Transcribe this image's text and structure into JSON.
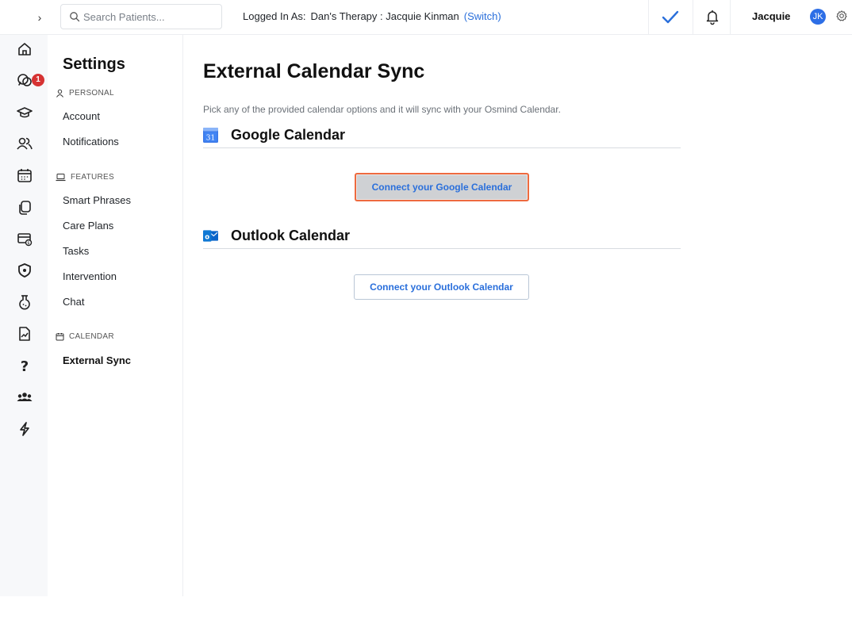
{
  "topbar": {
    "collapse_icon": "chevron-right-icon",
    "search_placeholder": "Search Patients...",
    "logged_in_label": "Logged In As:",
    "practice": "Dan's Therapy : Jacquie Kinman",
    "switch_label": "(Switch)",
    "user_name": "Jacquie",
    "avatar_initials": "JK",
    "accent_color": "#2a6fdb"
  },
  "rail": {
    "items": [
      "home-icon",
      "messages-icon",
      "education-icon",
      "patients-icon",
      "calendar-icon",
      "documents-icon",
      "billing-icon",
      "shield-icon",
      "labs-icon",
      "reports-icon",
      "help-icon",
      "team-icon",
      "lightning-icon"
    ],
    "messages_badge": "1"
  },
  "settings": {
    "title": "Settings",
    "personal_label": "PERSONAL",
    "personal_items": [
      "Account",
      "Notifications"
    ],
    "features_label": "FEATURES",
    "features_items": [
      "Smart Phrases",
      "Care Plans",
      "Tasks",
      "Intervention",
      "Chat"
    ],
    "calendar_label": "CALENDAR",
    "calendar_items": [
      "External Sync"
    ],
    "active_item": "External Sync"
  },
  "main": {
    "title": "External Calendar Sync",
    "description": "Pick any of the provided calendar options and it will sync with your Osmind Calendar.",
    "google": {
      "name": "Google Calendar",
      "icon_text": "31",
      "button_label": "Connect your Google Calendar"
    },
    "outlook": {
      "name": "Outlook Calendar",
      "icon_text": "o",
      "button_label": "Connect your Outlook Calendar"
    }
  }
}
